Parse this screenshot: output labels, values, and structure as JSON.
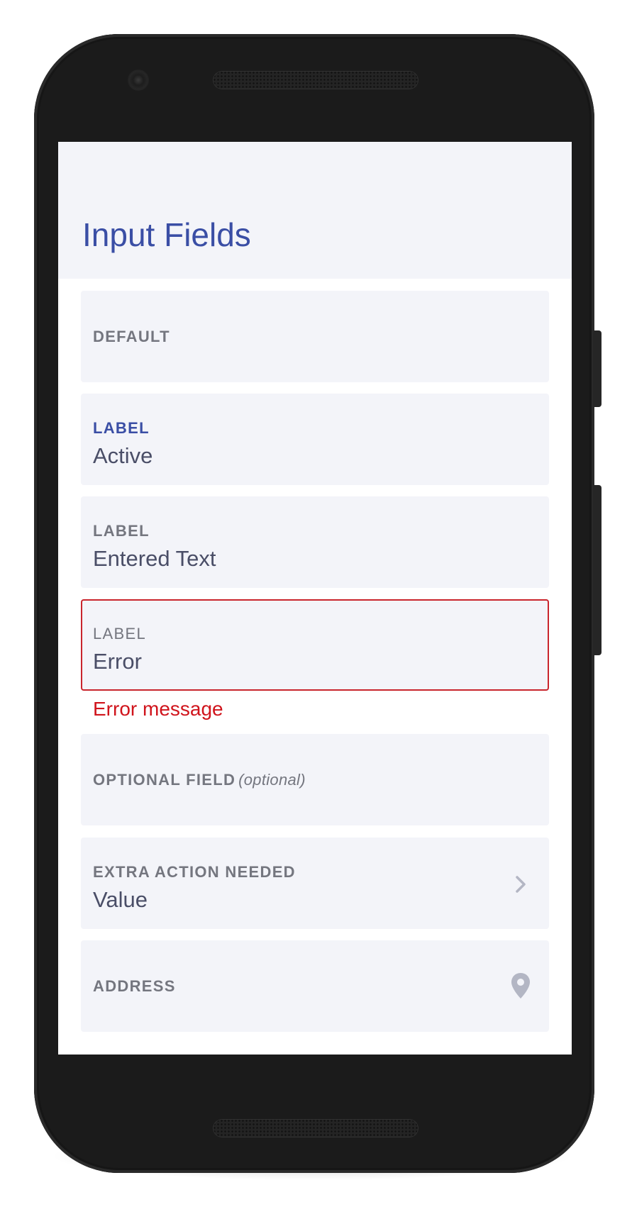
{
  "page": {
    "title": "Input Fields"
  },
  "fields": [
    {
      "label": "DEFAULT"
    },
    {
      "label": "LABEL",
      "value": "Active"
    },
    {
      "label": "LABEL",
      "value": "Entered Text"
    },
    {
      "label": "LABEL",
      "value": "Error",
      "error_message": "Error message"
    },
    {
      "label": "OPTIONAL FIELD",
      "hint": "(optional)"
    },
    {
      "label": "EXTRA ACTION NEEDED",
      "value": "Value",
      "icon": "chevron-right-icon"
    },
    {
      "label": "ADDRESS",
      "icon": "location-pin-icon"
    }
  ],
  "colors": {
    "accent": "#3a4ea5",
    "error": "#d0141c",
    "field_background": "#f3f4f9",
    "label": "#74767f",
    "value_text": "#4a4e67"
  }
}
